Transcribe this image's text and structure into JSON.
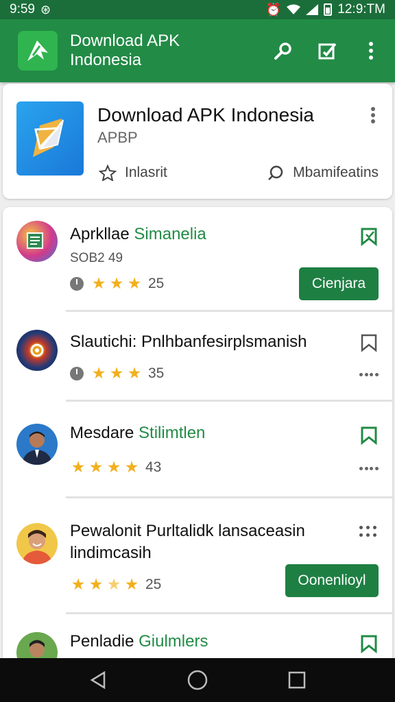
{
  "status_bar": {
    "time_left": "9:59",
    "time_right": "12:9:TM"
  },
  "app_bar": {
    "title": "Download APK Indonesia",
    "icons": [
      "search-icon",
      "edit-icon",
      "more-vert-icon"
    ]
  },
  "featured": {
    "name": "Download APK Indonesia",
    "publisher": "APBP",
    "action_left": "Inlasrit",
    "action_right": "Mbamifeatins",
    "icon": "apk-paper-plane-icon"
  },
  "list": [
    {
      "title": "Aprkllae",
      "title_accent": "Simanelia",
      "subtitle": "SOB2 49",
      "stars": 3,
      "rating_count": "25",
      "button_label": "Cienjara",
      "action": "bookmark"
    },
    {
      "title": "Slautichi: Pnlhbanfesirplsmanish",
      "title_accent": "",
      "stars": 3,
      "rating_count": "35",
      "action": "bookmark"
    },
    {
      "title": "Mesdare",
      "title_accent": "Stilimtlen",
      "stars": 4,
      "rating_count": "43",
      "action": "bookmark"
    },
    {
      "title": "Pewalonit Purltalidk lansaceasin lindimcasih",
      "title_accent": "",
      "stars": 2.5,
      "rating_count": "25",
      "button_label": "Oonenlioyl",
      "action": "grid"
    },
    {
      "title": "Penladie",
      "title_accent": "Giulmlers",
      "action": "bookmark"
    }
  ],
  "colors": {
    "primary": "#228b46",
    "primary_dark": "#1b6e3a",
    "star": "#f2b01e",
    "button": "#1e7f43"
  }
}
